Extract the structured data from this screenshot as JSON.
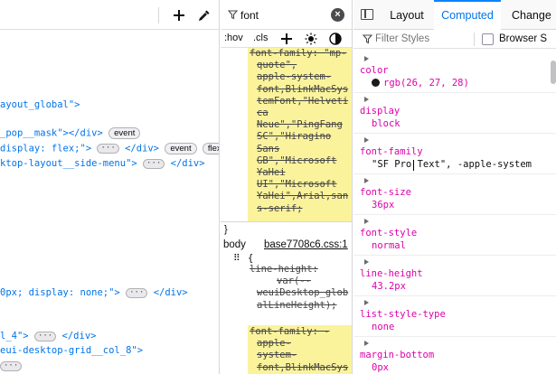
{
  "markup": {
    "lines": [
      {
        "pre": "ayout_global\">",
        "parts": []
      },
      {
        "pre": "_pop__mask\"></div>",
        "badges": [
          "event"
        ]
      },
      {
        "pre": "display: flex;\">",
        "dots": true,
        "post": "</div>",
        "badges": [
          "event",
          "flex"
        ]
      },
      {
        "pre": "ktop-layout__side-menu\">",
        "dots": true,
        "post": "</div>"
      },
      {
        "pre": "0px; display: none;\">",
        "dots": true,
        "post": "</div>"
      },
      {
        "pre": "l_4\">",
        "dots": true,
        "post": "</div>"
      },
      {
        "pre": "eui-desktop-grid__col_8\">"
      },
      {
        "pre": "",
        "dots": true
      }
    ]
  },
  "rules": {
    "filter_value": "font",
    "hov_label": ":hov",
    "cls_label": ".cls",
    "block1": [
      "font-family: \"mp-",
      "quote\",",
      "apple-system-",
      "font,BlinkMacSys",
      "temFont,\"Helveti",
      "ca",
      "Neue\",\"PingFang",
      "SC\",\"Hiragino",
      "Sans",
      "GB\",\"Microsoft",
      "YaHei",
      "UI\",\"Microsoft",
      "YaHei\",Arial,san",
      "s-serif;"
    ],
    "selector": "body",
    "source": "base7708c6.css:1",
    "brace": "{",
    "line_height_decl": [
      "line-height:",
      "var(--",
      "weuiDesktop_glob",
      "alLineHeight);"
    ],
    "block2": [
      "font-family: -",
      "apple-",
      "system-",
      "font,BlinkMacSys"
    ]
  },
  "computed": {
    "tabs": {
      "layout": "Layout",
      "computed": "Computed",
      "changes": "Change"
    },
    "filter_placeholder": "Filter Styles",
    "browser_styles": "Browser S",
    "props": [
      {
        "name": "color",
        "value": "rgb(26, 27, 28)",
        "swatch": "#1a1b1c"
      },
      {
        "name": "display",
        "value": "block"
      },
      {
        "name": "font-family",
        "value": "\"SF Pro Text\", -apple-system",
        "plain": true
      },
      {
        "name": "font-size",
        "value": "36px"
      },
      {
        "name": "font-style",
        "value": "normal"
      },
      {
        "name": "line-height",
        "value": "43.2px"
      },
      {
        "name": "list-style-type",
        "value": "none"
      },
      {
        "name": "margin-bottom",
        "value": "0px"
      }
    ]
  }
}
